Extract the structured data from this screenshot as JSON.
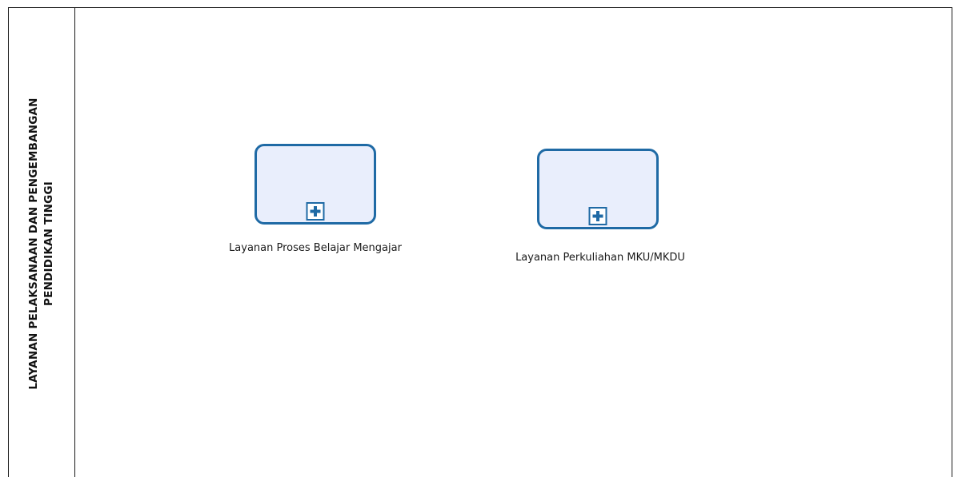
{
  "pool": {
    "title_line1": "LAYANAN PELAKSANAAN DAN PENGEMBANGAN",
    "title_line2": "PENDIDIKAN TINGGI"
  },
  "tasks": [
    {
      "label": "Layanan Proses Belajar Mengajar",
      "marker": "plus-icon"
    },
    {
      "label": "Layanan Perkuliahan MKU/MKDU",
      "marker": "plus-icon"
    }
  ],
  "colors": {
    "task_fill": "#e9eefc",
    "task_border": "#1f6aa5",
    "pool_border": "#1a1a1a"
  }
}
